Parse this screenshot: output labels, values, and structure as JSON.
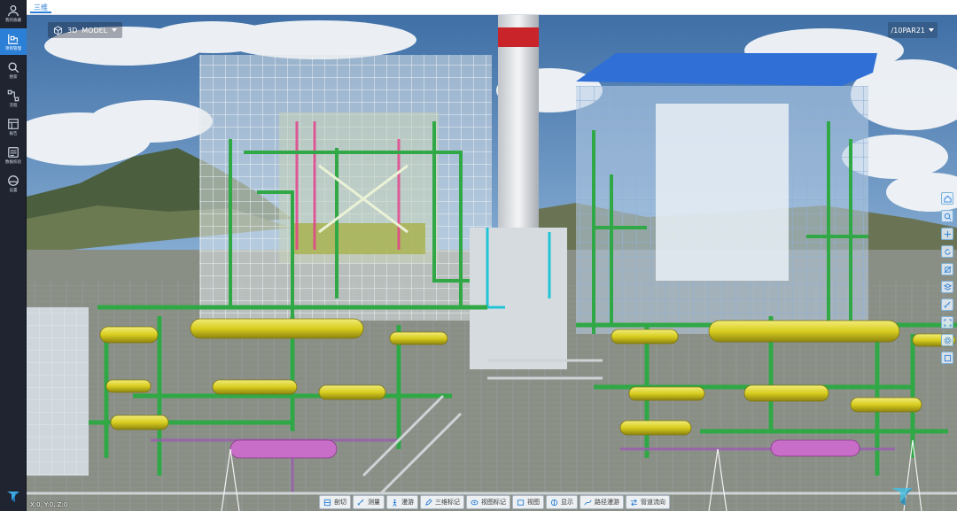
{
  "tabs": [
    {
      "label": "三维"
    }
  ],
  "sidebar": {
    "items": [
      {
        "label": "我的收藏",
        "icon": "user-icon"
      },
      {
        "label": "项目管理",
        "icon": "project-icon"
      },
      {
        "label": "搜索",
        "icon": "search-icon"
      },
      {
        "label": "流程",
        "icon": "flow-icon"
      },
      {
        "label": "报告",
        "icon": "report-icon"
      },
      {
        "label": "数据校验",
        "icon": "data-check-icon"
      },
      {
        "label": "设置",
        "icon": "settings-icon"
      }
    ],
    "active_index": 1
  },
  "viewport": {
    "mode_label": "3D",
    "model_label": "MODEL",
    "layer_label": "/10PAR21",
    "coords": "X:0, Y:0, Z:0"
  },
  "right_tools": [
    "home-view-icon",
    "zoom-icon",
    "pan-icon",
    "rotate-icon",
    "section-icon",
    "layers-icon",
    "measure-icon",
    "fit-icon",
    "settings-icon",
    "fullscreen-icon"
  ],
  "bottom_toolbar": [
    {
      "label": "剖切",
      "icon": "cut-icon"
    },
    {
      "label": "测量",
      "icon": "measure-icon"
    },
    {
      "label": "漫游",
      "icon": "walk-icon"
    },
    {
      "label": "三维标记",
      "icon": "markup-icon"
    },
    {
      "label": "视图标记",
      "icon": "view-markup-icon"
    },
    {
      "label": "视图",
      "icon": "view-icon"
    },
    {
      "label": "显示",
      "icon": "display-icon"
    },
    {
      "label": "路径漫游",
      "icon": "path-icon"
    },
    {
      "label": "管道流向",
      "icon": "flow-direction-icon"
    }
  ],
  "colors": {
    "sidebar_bg": "#1f2430",
    "accent": "#2b7fd6",
    "sky": "#6f9fcf",
    "steel_white": "#e6ecf2",
    "pipe_green": "#2fa845",
    "vessel_yellow": "#d9cf28",
    "roof_blue": "#2f6fd6",
    "chimney_red": "#c8242a"
  }
}
